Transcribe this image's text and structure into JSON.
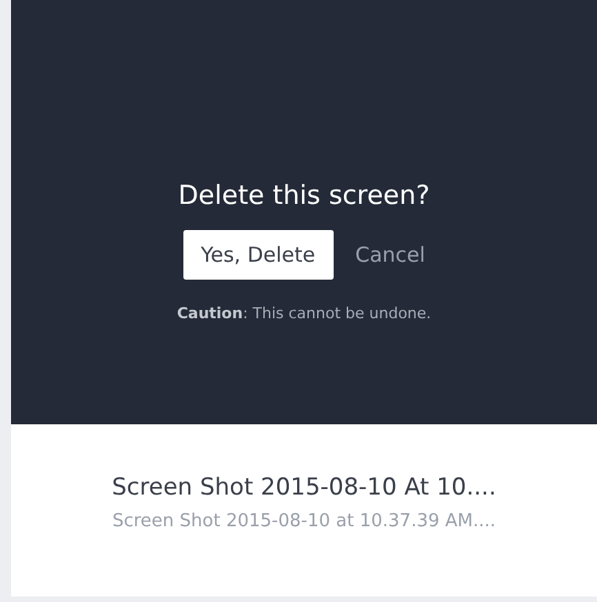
{
  "dialog": {
    "title": "Delete this screen?",
    "confirm_button": "Yes, Delete",
    "cancel_link": "Cancel",
    "caution": "**Caution**: This cannot be undone."
  },
  "screen": {
    "title": "Screen Shot 2015-08-10 At 10....",
    "filename": "Screen Shot 2015-08-10 at 10.37.39 AM...."
  }
}
